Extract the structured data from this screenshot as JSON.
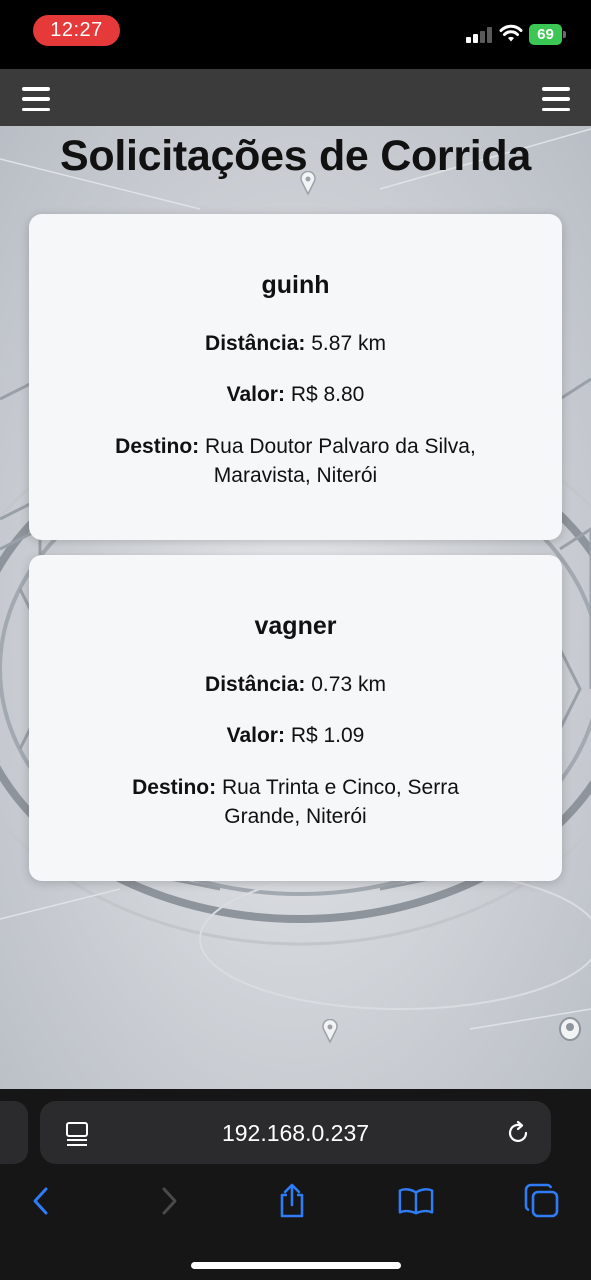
{
  "status_bar": {
    "time": "12:27",
    "battery": "69"
  },
  "page": {
    "title": "Solicitações de Corrida",
    "requests": [
      {
        "name": "guinh",
        "distance_label": "Distância:",
        "distance": "5.87 km",
        "value_label": "Valor:",
        "value": "R$ 8.80",
        "destination_label": "Destino:",
        "destination": "Rua Doutor Palvaro da Silva, Maravista, Niterói"
      },
      {
        "name": "vagner",
        "distance_label": "Distância:",
        "distance": "0.73 km",
        "value_label": "Valor:",
        "value": "R$ 1.09",
        "destination_label": "Destino:",
        "destination": "Rua Trinta e Cinco, Serra Grande, Niterói"
      }
    ]
  },
  "browser": {
    "url": "192.168.0.237"
  },
  "colors": {
    "accent": "#2f7cf6",
    "card_bg": "#f6f7f9",
    "nav_bg": "#3b3b3b",
    "time_pill": "#e5393a",
    "battery": "#3cc653"
  },
  "icons": [
    "menu-icon",
    "menu-icon",
    "reader-icon",
    "reload-icon",
    "back-icon",
    "forward-icon",
    "share-icon",
    "bookmarks-icon",
    "tabs-icon"
  ]
}
